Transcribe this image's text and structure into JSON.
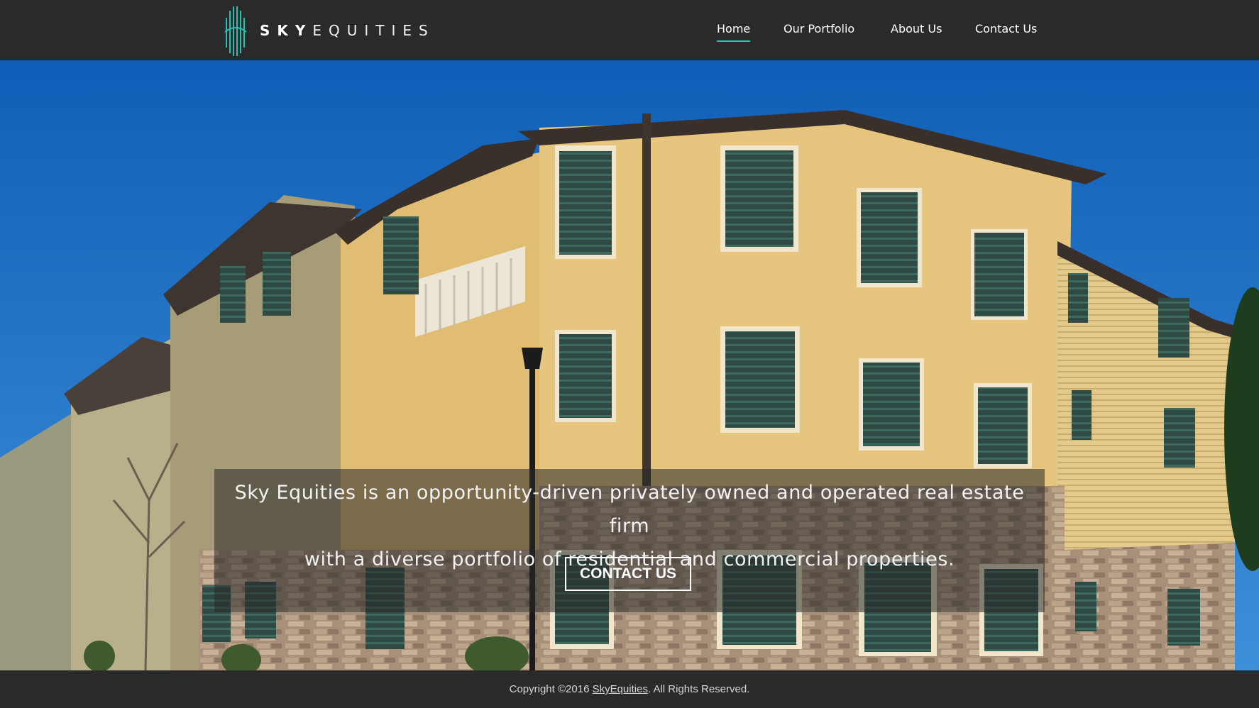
{
  "brand": {
    "name_bold": "SKY",
    "name_light": "EQUITIES",
    "accent_color": "#2bbfb0"
  },
  "nav": {
    "items": [
      {
        "label": "Home",
        "active": true
      },
      {
        "label": "Our Portfolio",
        "active": false
      },
      {
        "label": "About Us",
        "active": false
      },
      {
        "label": "Contact Us",
        "active": false
      }
    ]
  },
  "hero": {
    "tagline_line1": "Sky Equities is an opportunity-driven privately owned and operated real estate firm",
    "tagline_line2": "with a diverse portfolio of residential and commercial properties.",
    "cta_label": "CONTACT US"
  },
  "footer": {
    "prefix": "Copyright ©2016 ",
    "link": "SkyEquities",
    "suffix": ". All Rights Reserved."
  },
  "colors": {
    "header_bg": "#2a2a2a",
    "sky": "#1c75c9",
    "building_yellow": "#e6c57e"
  }
}
